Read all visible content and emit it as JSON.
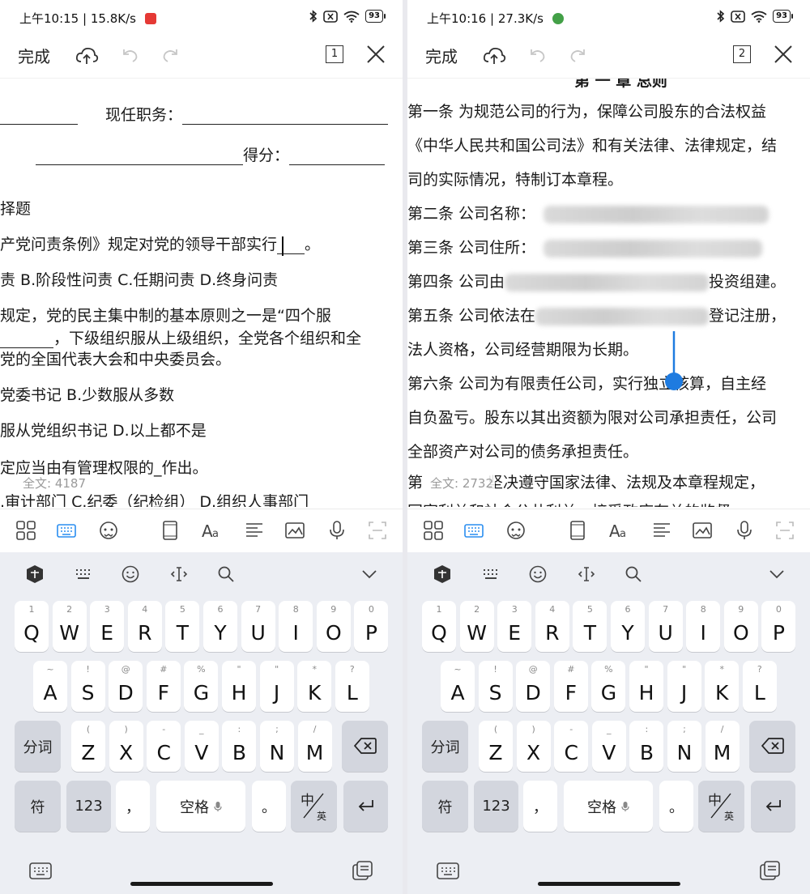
{
  "left": {
    "status": {
      "time": "上午10:15",
      "speed": "15.8K/s",
      "battery": "93",
      "app_badge_color": "#e53935"
    },
    "toolbar": {
      "done": "完成",
      "page_num": "1"
    },
    "doc_lines": [
      {
        "pre": "",
        "post": "现任职务："
      },
      {
        "pre": "",
        "post": "得分："
      },
      {
        "text": "择题"
      },
      {
        "pre": "产党问责条例》规定对党的领导干部实行",
        "post": "。"
      },
      {
        "text": "责  B.阶段性问责   C.任期问责  D.终身问责"
      },
      {
        "text": "规定，党的民主集中制的基本原则之一是“四个服"
      },
      {
        "text": "，下级组织服从上级组织，全党各个组织和全"
      },
      {
        "text": "党的全国代表大会和中央委员会。"
      },
      {
        "text": "党委书记  B.少数服从多数"
      },
      {
        "text": "服从党组织书记     D.以上都不是"
      },
      {
        "text": "定应当由有管理权限的_作出。"
      },
      {
        "text": ".审计部门  C.纪委（纪检组）  D.组织人事部门"
      }
    ],
    "word_count": "全文: 4187"
  },
  "right": {
    "status": {
      "time": "上午10:16",
      "speed": "27.3K/s",
      "battery": "93",
      "app_badge_color": "#43a047"
    },
    "toolbar": {
      "done": "完成",
      "page_num": "2"
    },
    "chapter_fragment": "第 一 章  总则",
    "doc_lines": [
      {
        "text": "第一条  为规范公司的行为，保障公司股东的合法权益"
      },
      {
        "text": "《中华人民共和国公司法》和有关法律、法律规定，结"
      },
      {
        "text": "司的实际情况，特制订本章程。"
      },
      {
        "text": "第二条  公司名称："
      },
      {
        "text": "第三条  公司住所："
      },
      {
        "pre": "第四条  公司由",
        "post": "投资组建。"
      },
      {
        "pre": "第五条  公司依法在",
        "post": "登记注册，"
      },
      {
        "text": "法人资格，公司经营期限为长期。"
      },
      {
        "text": "第六条  公司为有限责任公司，实行独立核算，自主经"
      },
      {
        "text": "自负盈亏。股东以其出资额为限对公司承担责任，公司"
      },
      {
        "text": "全部资产对公司的债务承担责任。"
      },
      {
        "pre": "第",
        "post": "坚决遵守国家法律、法规及本章程规定，"
      },
      {
        "text": "国家利益和社会公共利益，接受政府有关的监督。"
      }
    ],
    "word_count": "全文: 2732"
  },
  "keyboard": {
    "row1": [
      {
        "main": "Q",
        "sub": "1"
      },
      {
        "main": "W",
        "sub": "2"
      },
      {
        "main": "E",
        "sub": "3"
      },
      {
        "main": "R",
        "sub": "4"
      },
      {
        "main": "T",
        "sub": "5"
      },
      {
        "main": "Y",
        "sub": "6"
      },
      {
        "main": "U",
        "sub": "7"
      },
      {
        "main": "I",
        "sub": "8"
      },
      {
        "main": "O",
        "sub": "9"
      },
      {
        "main": "P",
        "sub": "0"
      }
    ],
    "row2": [
      {
        "main": "A",
        "sub": "~"
      },
      {
        "main": "S",
        "sub": "!"
      },
      {
        "main": "D",
        "sub": "@"
      },
      {
        "main": "F",
        "sub": "#"
      },
      {
        "main": "G",
        "sub": "%"
      },
      {
        "main": "H",
        "sub": "\""
      },
      {
        "main": "J",
        "sub": "\""
      },
      {
        "main": "K",
        "sub": "*"
      },
      {
        "main": "L",
        "sub": "?"
      }
    ],
    "row3": [
      {
        "main": "Z",
        "sub": "("
      },
      {
        "main": "X",
        "sub": ")"
      },
      {
        "main": "C",
        "sub": "-"
      },
      {
        "main": "V",
        "sub": "_"
      },
      {
        "main": "B",
        "sub": ":"
      },
      {
        "main": "N",
        "sub": ";"
      },
      {
        "main": "M",
        "sub": "/"
      }
    ],
    "fenci": "分词",
    "fu": "符",
    "num": "123",
    "comma": "，",
    "space": "空格",
    "period": "。",
    "zh": "中",
    "en": "英"
  }
}
